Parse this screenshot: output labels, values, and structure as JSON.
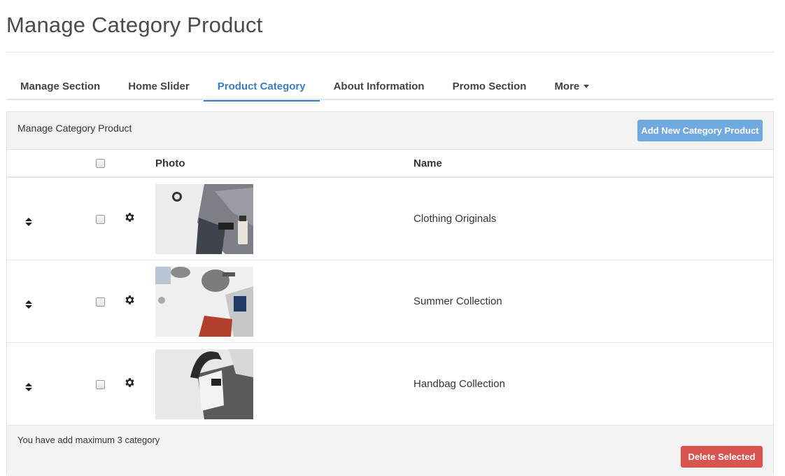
{
  "page": {
    "title": "Manage Category Product"
  },
  "tabs": [
    {
      "label": "Manage Section",
      "active": false
    },
    {
      "label": "Home Slider",
      "active": false
    },
    {
      "label": "Product Category",
      "active": true
    },
    {
      "label": "About Information",
      "active": false
    },
    {
      "label": "Promo Section",
      "active": false
    },
    {
      "label": "More",
      "active": false,
      "dropdown": true
    }
  ],
  "panel": {
    "heading": "Manage Category Product",
    "add_button_label": "Add New Category Product",
    "columns": {
      "photo": "Photo",
      "name": "Name"
    },
    "rows": [
      {
        "name": "Clothing Originals",
        "photo_icon": "clothing-photo"
      },
      {
        "name": "Summer Collection",
        "photo_icon": "summer-photo"
      },
      {
        "name": "Handbag Collection",
        "photo_icon": "handbag-photo"
      }
    ],
    "footer_text": "You have add maximum 3 category",
    "delete_button_label": "Delete Selected"
  },
  "colors": {
    "accent": "#3b7dc4",
    "add_button": "#6fa9df",
    "delete_button": "#d9534f",
    "panel_bg": "#f3f3f3"
  }
}
